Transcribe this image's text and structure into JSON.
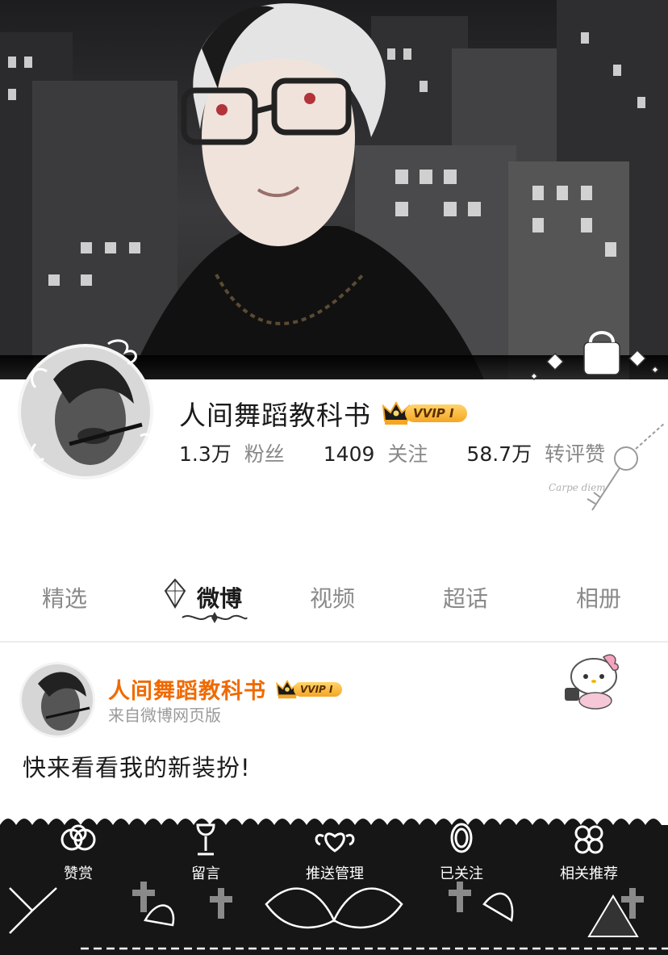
{
  "profile": {
    "name": "人间舞蹈教科书",
    "vip_label": "VVIP I",
    "stats": [
      {
        "value": "1.3万",
        "label": "粉丝"
      },
      {
        "value": "1409",
        "label": "关注"
      },
      {
        "value": "58.7万",
        "label": "转评赞"
      }
    ],
    "deco_text": "Carpe diem"
  },
  "tabs": [
    {
      "label": "精选",
      "active": false
    },
    {
      "label": "微博",
      "active": true
    },
    {
      "label": "视频",
      "active": false
    },
    {
      "label": "超话",
      "active": false
    },
    {
      "label": "相册",
      "active": false
    }
  ],
  "post": {
    "author": "人间舞蹈教科书",
    "vip_label": "VVIP I",
    "source": "来自微博网页版",
    "text": "快来看看我的新装扮!"
  },
  "actions": [
    {
      "label": "赞赏",
      "icon": "knot-icon"
    },
    {
      "label": "留言",
      "icon": "goblet-icon"
    },
    {
      "label": "推送管理",
      "icon": "winged-heart-icon"
    },
    {
      "label": "已关注",
      "icon": "mirror-icon"
    },
    {
      "label": "相关推荐",
      "icon": "clover-icon"
    }
  ],
  "colors": {
    "author_orange": "#f06a00",
    "vip_gold": "#f5a623",
    "bar_dark": "#161616"
  }
}
